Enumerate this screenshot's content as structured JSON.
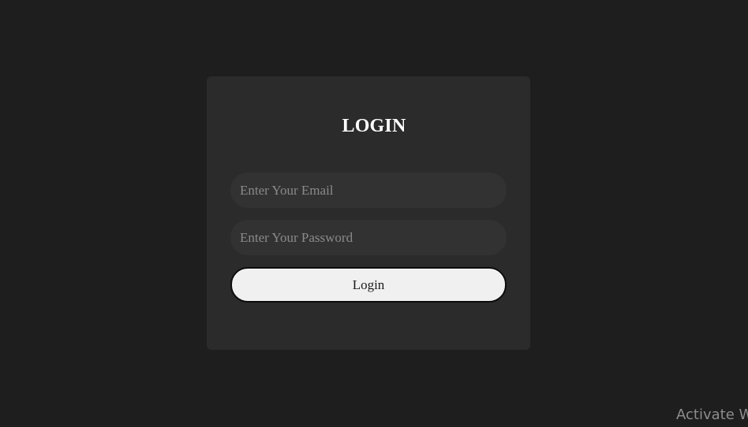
{
  "login_form": {
    "title": "LOGIN",
    "email_placeholder": "Enter Your Email",
    "email_value": "",
    "password_placeholder": "Enter Your Password",
    "password_value": "",
    "submit_label": "Login"
  },
  "watermark": {
    "text": "Activate W"
  },
  "colors": {
    "page_background": "#1e1e1e",
    "card_background": "#2b2b2b",
    "input_background": "#323232",
    "button_background": "#f0f0f0",
    "title_color": "#ffffff"
  }
}
